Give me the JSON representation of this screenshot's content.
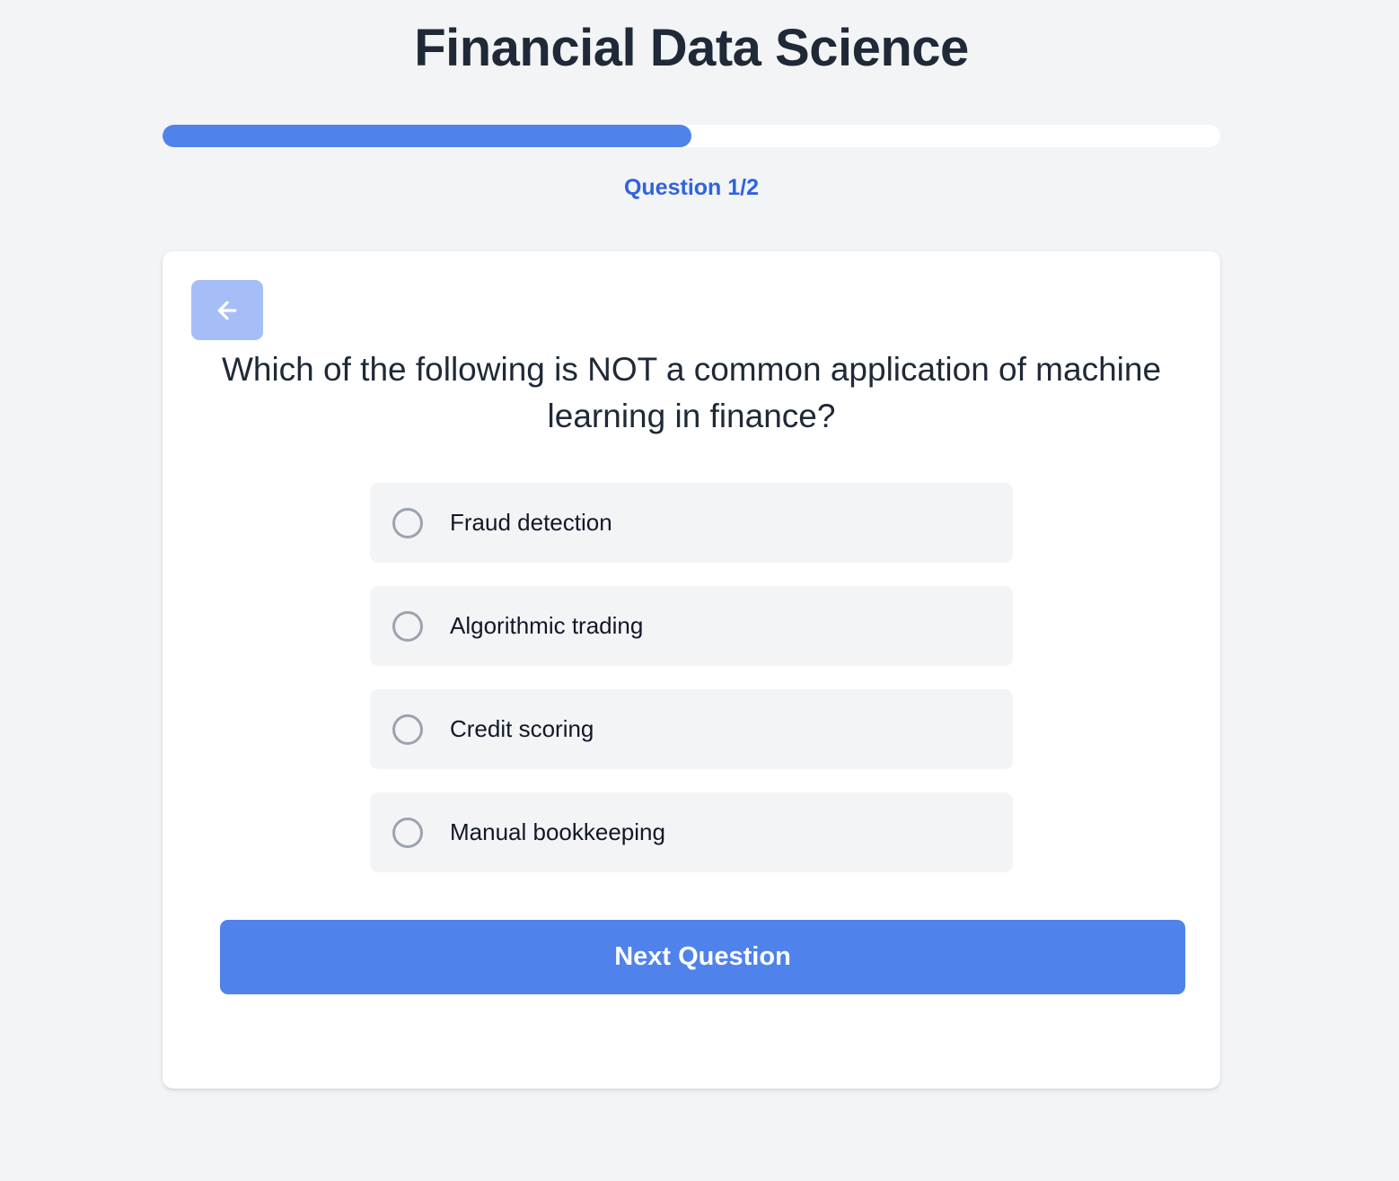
{
  "header": {
    "title": "Financial Data Science"
  },
  "progress": {
    "label": "Question 1/2",
    "fraction": 0.5,
    "color": "#4f82eb"
  },
  "card": {
    "back_icon": "arrow-left-icon",
    "question": "Which of the following is NOT a common application of machine learning in finance?",
    "options": [
      {
        "label": "Fraud detection"
      },
      {
        "label": "Algorithmic trading"
      },
      {
        "label": "Credit scoring"
      },
      {
        "label": "Manual bookkeeping"
      }
    ],
    "next_label": "Next Question"
  },
  "colors": {
    "accent": "#4f82eb",
    "accent_text": "#2f63de",
    "back_button": "#a5bef7",
    "background": "#f3f4f6"
  }
}
